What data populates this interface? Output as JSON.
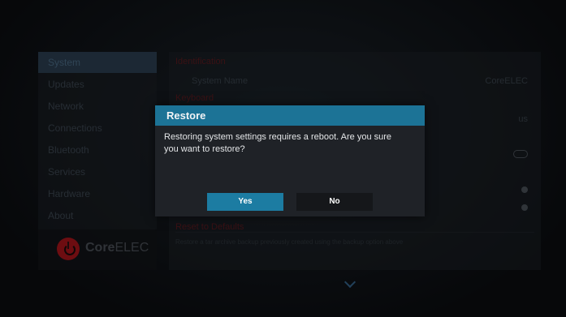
{
  "sidebar": {
    "items": [
      {
        "label": "System"
      },
      {
        "label": "Updates"
      },
      {
        "label": "Network"
      },
      {
        "label": "Connections"
      },
      {
        "label": "Bluetooth"
      },
      {
        "label": "Services"
      },
      {
        "label": "Hardware"
      },
      {
        "label": "About"
      }
    ],
    "active_index": 0,
    "logo": {
      "text_bold": "Core",
      "text_rest": "ELEC"
    }
  },
  "content": {
    "section_identification": "Identification",
    "system_name_label": "System Name",
    "system_name_value": "CoreELEC",
    "section_keyboard": "Keyboard",
    "keyboard_value": "us",
    "section_reset": "Reset to Defaults",
    "description": "Restore a tar archive backup previously created using the backup option above"
  },
  "dialog": {
    "title": "Restore",
    "message": "Restoring system settings requires a reboot. Are you sure you want to restore?",
    "yes_label": "Yes",
    "no_label": "No",
    "header_color": "#1c7396",
    "focus_color": "#1c7ca2"
  },
  "icons": [
    "chevron-down-icon",
    "toggle-icon",
    "radio-dot-icon",
    "power-icon"
  ]
}
